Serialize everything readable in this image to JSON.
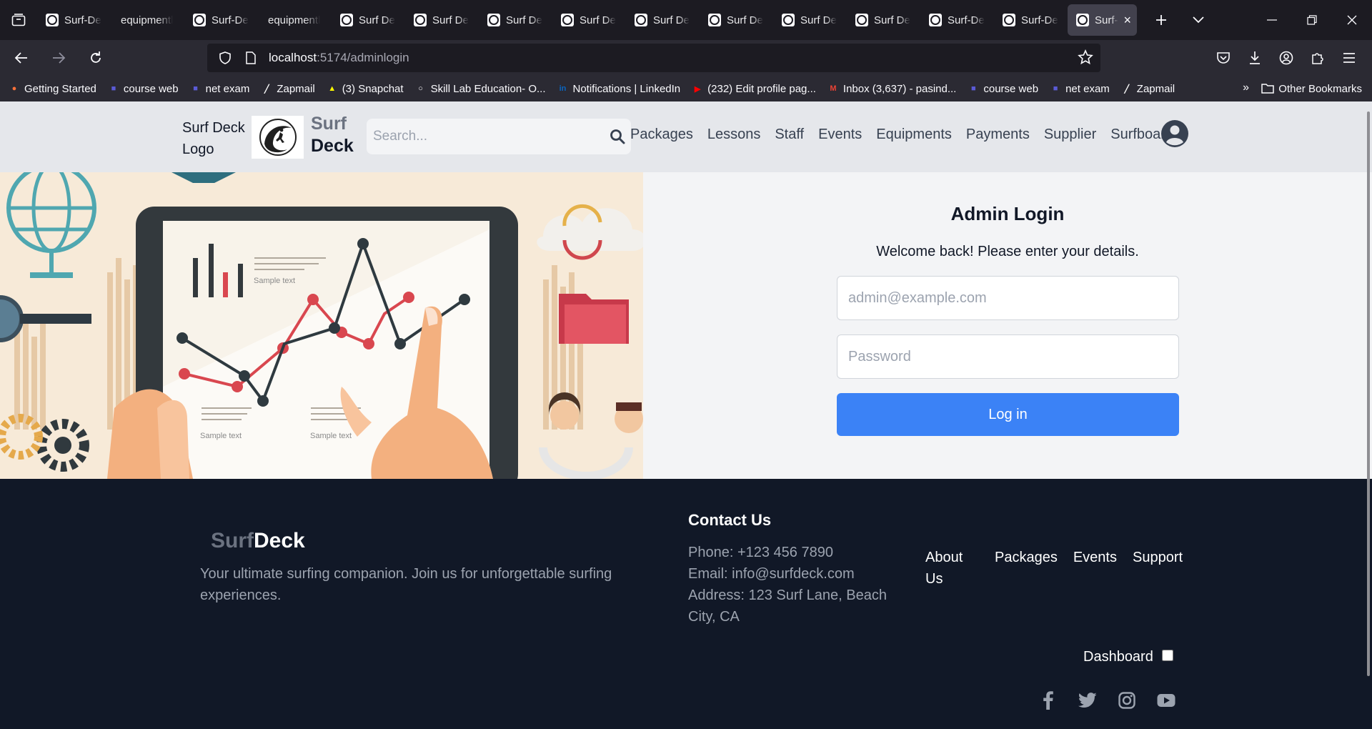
{
  "browser": {
    "tabs": [
      {
        "label": "Surf-De",
        "icon": true
      },
      {
        "label": "equipmentl",
        "icon": false
      },
      {
        "label": "Surf-De",
        "icon": true
      },
      {
        "label": "equipmentl",
        "icon": false
      },
      {
        "label": "Surf De",
        "icon": true
      },
      {
        "label": "Surf De",
        "icon": true
      },
      {
        "label": "Surf De",
        "icon": true
      },
      {
        "label": "Surf De",
        "icon": true
      },
      {
        "label": "Surf De",
        "icon": true
      },
      {
        "label": "Surf De",
        "icon": true
      },
      {
        "label": "Surf De",
        "icon": true
      },
      {
        "label": "Surf De",
        "icon": true
      },
      {
        "label": "Surf-De",
        "icon": true
      },
      {
        "label": "Surf-De",
        "icon": true
      },
      {
        "label": "Surf-",
        "icon": true,
        "active": true
      }
    ],
    "url_host": "localhost",
    "url_path": ":5174/adminlogin",
    "bookmarks": [
      {
        "label": "Getting Started",
        "icon": "firefox-icon",
        "color": "#ff7139"
      },
      {
        "label": "course web",
        "icon": "university-icon",
        "color": "#5b5bd6"
      },
      {
        "label": "net exam",
        "icon": "university-icon",
        "color": "#5b5bd6"
      },
      {
        "label": "Zapmail",
        "icon": "zapmail-icon",
        "color": "#ffffff"
      },
      {
        "label": "(3) Snapchat",
        "icon": "snapchat-icon",
        "color": "#fffc00"
      },
      {
        "label": "Skill Lab Education- O...",
        "icon": "globe-icon",
        "color": "#fbfbfe"
      },
      {
        "label": "Notifications | LinkedIn",
        "icon": "linkedin-icon",
        "color": "#0a66c2"
      },
      {
        "label": "(232) Edit profile pag...",
        "icon": "youtube-icon",
        "color": "#ff0000"
      },
      {
        "label": "Inbox (3,637) - pasind...",
        "icon": "gmail-icon",
        "color": "#ea4335"
      },
      {
        "label": "course web",
        "icon": "university-icon",
        "color": "#5b5bd6"
      },
      {
        "label": "net exam",
        "icon": "university-icon",
        "color": "#5b5bd6"
      },
      {
        "label": "Zapmail",
        "icon": "zapmail-icon",
        "color": "#ffffff"
      }
    ],
    "other_bookmarks": "Other Bookmarks"
  },
  "header": {
    "logo_alt": "Surf Deck Logo",
    "logo_word1": "Surf",
    "logo_word2": "Deck",
    "search_placeholder": "Search...",
    "menu": [
      "Packages",
      "Lessons",
      "Staff",
      "Events",
      "Equipments",
      "Payments",
      "Supplier",
      "Surfboards"
    ]
  },
  "login": {
    "title": "Admin Login",
    "welcome": "Welcome back! Please enter your details.",
    "email_placeholder": "admin@example.com",
    "password_placeholder": "Password",
    "button": "Log in"
  },
  "hero": {
    "sample_text": "Sample text"
  },
  "footer": {
    "brand1": "Surf",
    "brand2": "Deck",
    "tagline": "Your ultimate surfing companion. Join us for unforgettable surfing experiences.",
    "contact_title": "Contact Us",
    "phone": "Phone: +123 456 7890",
    "email": "Email: info@surfdeck.com",
    "address": "Address: 123 Surf Lane, Beach City, CA",
    "links": [
      "About Us",
      "Packages",
      "Events",
      "Support"
    ],
    "dashboard": "Dashboard",
    "socials": [
      "facebook-icon",
      "twitter-icon",
      "instagram-icon",
      "youtube-icon"
    ]
  },
  "colors": {
    "primary_button": "#3b82f6",
    "footer_bg": "#111827",
    "header_bg": "#e5e7eb"
  }
}
